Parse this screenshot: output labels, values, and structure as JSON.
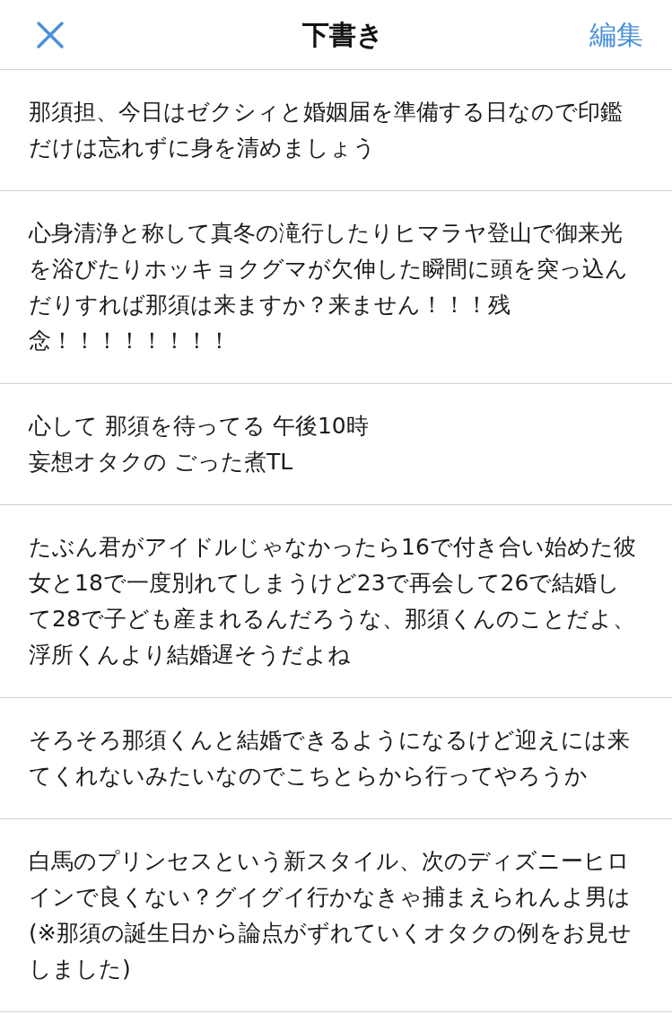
{
  "nav_bar": {
    "title": "下書き",
    "edit_button": "編集"
  },
  "drafts": [
    {
      "text": "那須担、今日はゼクシィと婚姻届を準備する日なので印鑑だけは忘れずに身を清めましょう"
    },
    {
      "text": "心身清浄と称して真冬の滝行したりヒマラヤ登山で御来光を浴びたりホッキョクグマが欠伸した瞬間に頭を突っ込んだりすれば那須は来ますか？来ません！！！残念！！！！！！！！"
    },
    {
      "text": "心して 那須を待ってる 午後10時",
      "second_line": "妄想オタクの ごった煮TL"
    },
    {
      "text": "たぶん君がアイドルじゃなかったら16で付き合い始めた彼女と18で一度別れてしまうけど23で再会して26で結婚して28で子ども産まれるんだろうな、那須くんのことだよ、浮所くんより結婚遅そうだよね"
    },
    {
      "text": "そろそろ那須くんと結婚できるようになるけど迎えには来てくれないみたいなのでこちとらから行ってやろうか"
    },
    {
      "text": "白馬のプリンセスという新スタイル、次のディズニーヒロインで良くない？グイグイ行かなきゃ捕まえられんよ男は(※那須の誕生日から論点がずれていくオタクの例をお見せしました)"
    }
  ]
}
